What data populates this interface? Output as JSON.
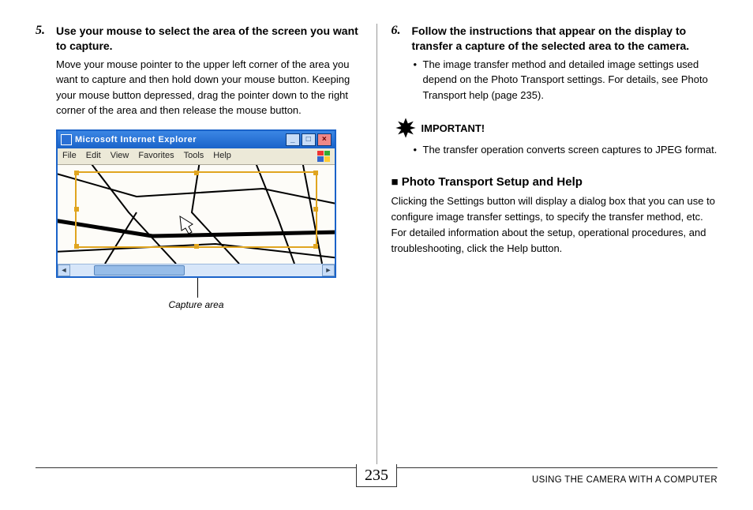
{
  "left": {
    "step_num": "5.",
    "step_title": "Use your mouse to select the area of the screen you want to capture.",
    "step_text": "Move your mouse pointer to the upper left corner of the area you want to capture and then hold down your mouse button. Keeping your mouse button depressed, drag the pointer down to the right corner of the area and then release the mouse button.",
    "window": {
      "title": "Microsoft Internet Explorer",
      "menu": [
        "File",
        "Edit",
        "View",
        "Favorites",
        "Tools",
        "Help"
      ]
    },
    "caption": "Capture area"
  },
  "right": {
    "step_num": "6.",
    "step_title": "Follow the instructions that appear on the display to transfer a capture of the selected area to the camera.",
    "bullets": [
      "The image transfer method and detailed image settings used depend on the Photo Transport settings. For details, see Photo Transport help (page 235)."
    ],
    "important_label": "IMPORTANT!",
    "important_bullets": [
      "The transfer operation converts screen captures to JPEG format."
    ],
    "section_marker": "■",
    "section_title": "Photo Transport Setup and Help",
    "section_para": "Clicking the Settings button will display a dialog box that you can use to configure image transfer settings, to specify the transfer method, etc. For detailed information about the setup, operational procedures, and troubleshooting, click the Help button."
  },
  "footer": {
    "page": "235",
    "text": "USING THE CAMERA WITH A COMPUTER"
  }
}
